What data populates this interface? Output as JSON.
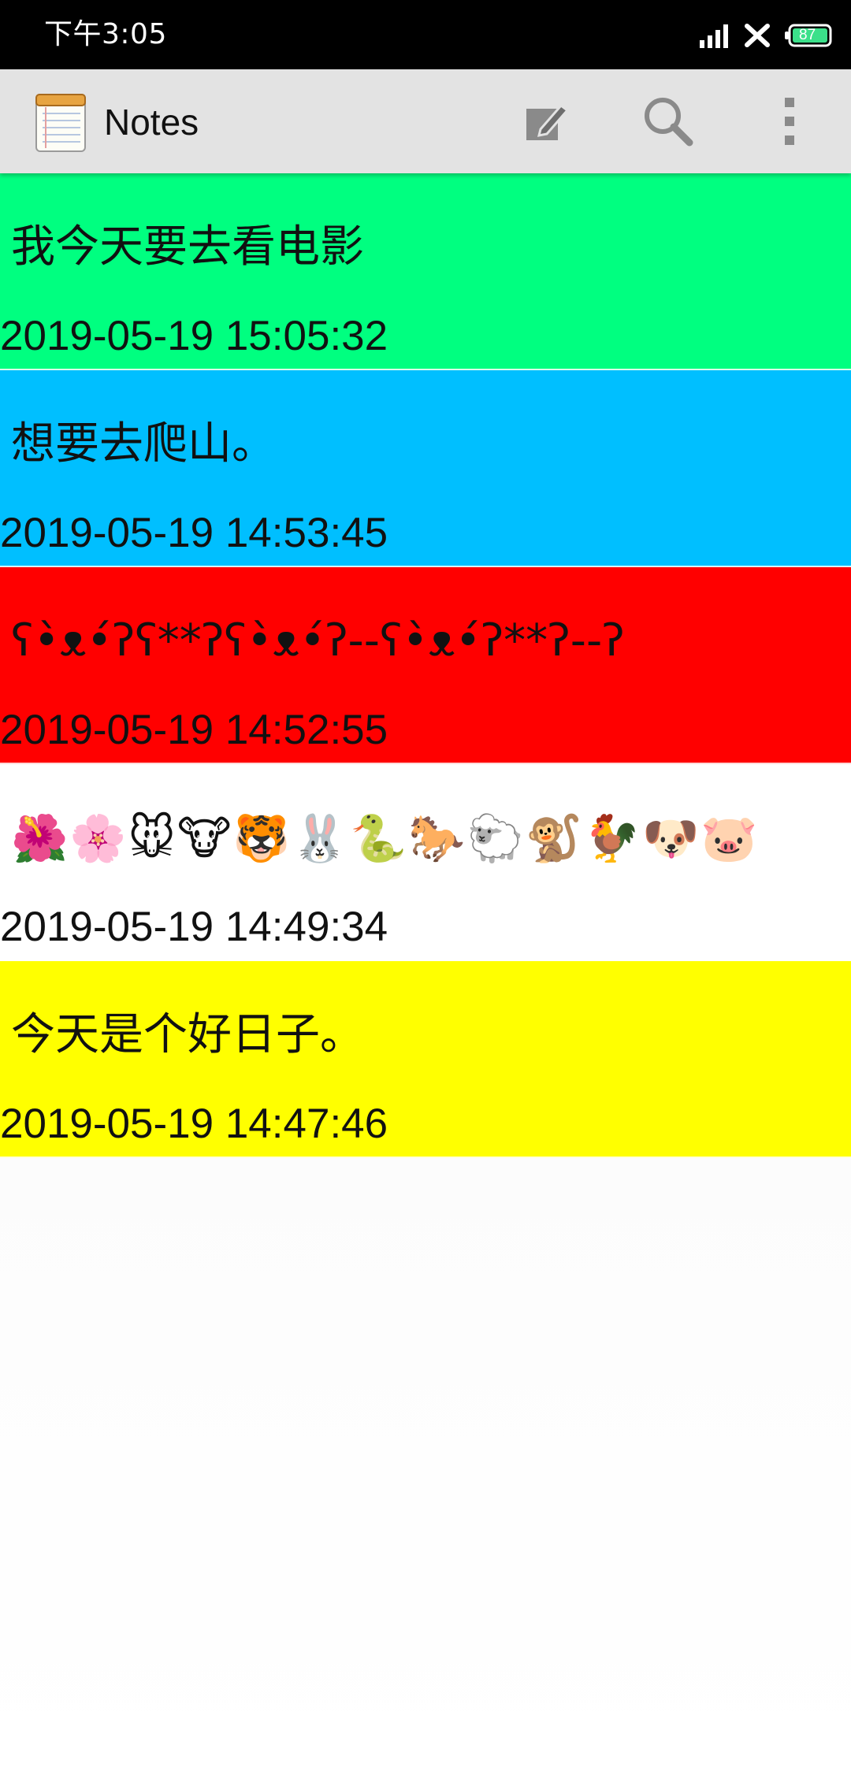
{
  "status_bar": {
    "time": "下午3:05",
    "battery_level": "87",
    "icons": [
      "signal-icon",
      "no-sim-icon",
      "battery-icon"
    ]
  },
  "action_bar": {
    "title": "Notes",
    "app_icon": "notepad-icon",
    "actions": {
      "new_note_icon": "edit-note-icon",
      "search_icon": "search-icon",
      "more_icon": "overflow-menu-icon"
    }
  },
  "notes": [
    {
      "title": "我今天要去看电影",
      "date": "2019-05-19 15:05:32",
      "color": "#00ff80"
    },
    {
      "title": "想要去爬山。",
      "date": "2019-05-19 14:53:45",
      "color": "#00bfff"
    },
    {
      "title": "ʕ•̀ᴥ•́ʔʕ**ʔʕ•̀ᴥ•́ʔ--ʕ•̀ᴥ•́ʔ**ʔ--ʔ",
      "date": "2019-05-19 14:52:55",
      "color": "#ff0000"
    },
    {
      "title": "🌺🌸🐭🐮🐯🐰🐍🐎🐑🐒🐓🐶🐷",
      "date": "2019-05-19 14:49:34",
      "color": "#ffffff"
    },
    {
      "title": "今天是个好日子。",
      "date": "2019-05-19 14:47:46",
      "color": "#ffff00"
    }
  ]
}
